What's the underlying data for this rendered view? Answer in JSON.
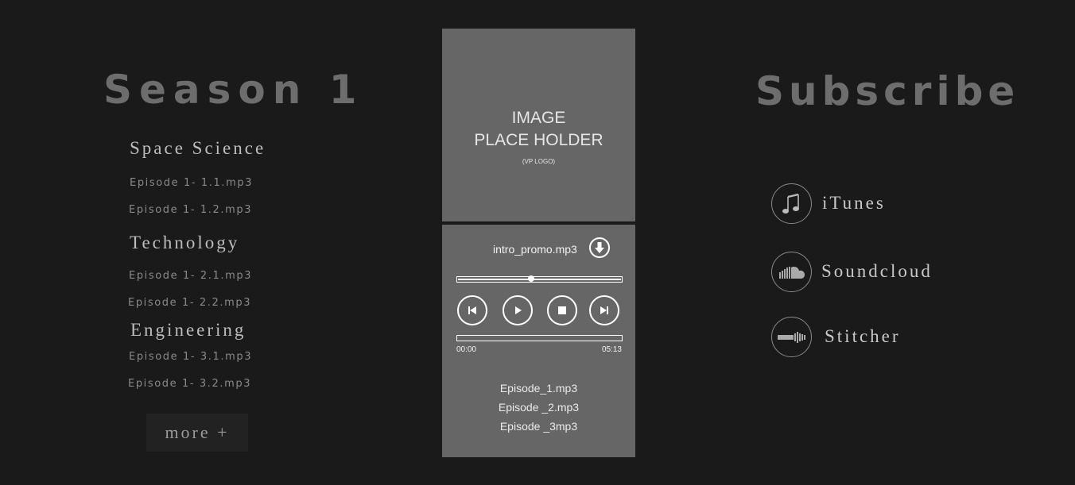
{
  "season": {
    "title": "Season 1",
    "categories": [
      {
        "name": "Space Science",
        "episodes": [
          "Episode 1- 1.1.mp3",
          "Episode 1- 1.2.mp3"
        ]
      },
      {
        "name": "Technology",
        "episodes": [
          "Episode 1- 2.1.mp3",
          "Episode 1- 2.2.mp3"
        ]
      },
      {
        "name": "Engineering",
        "episodes": [
          "Episode 1- 3.1.mp3",
          "Episode 1- 3.2.mp3"
        ]
      }
    ],
    "more_label": "more +"
  },
  "image_placeholder": {
    "line1": "IMAGE",
    "line2": "PLACE HOLDER",
    "line3": "(VP LOGO)"
  },
  "player": {
    "track": "intro_promo.mp3",
    "seek_fraction": 0.45,
    "progress_fraction": 0.0,
    "time_current": "00:00",
    "time_total": "05:13",
    "playlist": [
      "Episode_1.mp3",
      "Episode _2.mp3",
      "Episode _3mp3"
    ],
    "icons": [
      "download-icon",
      "previous-icon",
      "play-icon",
      "stop-icon",
      "next-icon"
    ]
  },
  "subscribe": {
    "title": "Subscribe",
    "items": [
      {
        "label": "iTunes",
        "icon": "music-note-icon"
      },
      {
        "label": "Soundcloud",
        "icon": "soundcloud-icon"
      },
      {
        "label": "Stitcher",
        "icon": "stitcher-icon"
      }
    ]
  },
  "colors": {
    "background": "#1a1a1a",
    "panel": "#666666",
    "heading": "#6d6d6d"
  }
}
